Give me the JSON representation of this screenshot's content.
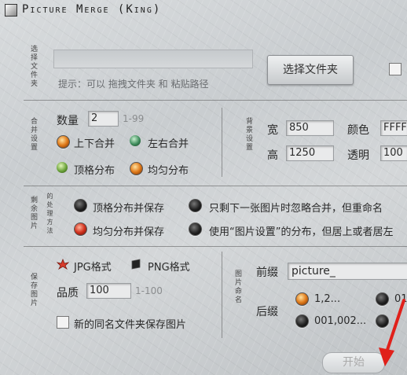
{
  "window": {
    "title": "Picture Merge (King)"
  },
  "folder": {
    "label": "选择文件夹",
    "path_value": "",
    "hint": "提示：可以 拖拽文件夹 和 粘贴路径",
    "select_button": "选择文件夹"
  },
  "merge": {
    "label": "合并设置",
    "count_label": "数量",
    "count_value": "2",
    "count_range": "1-99",
    "options": [
      "上下合并",
      "左右合并",
      "顶格分布",
      "均匀分布"
    ]
  },
  "bg": {
    "label": "背景设置",
    "width_label": "宽",
    "width_value": "850",
    "height_label": "高",
    "height_value": "1250",
    "color_label": "颜色",
    "color_value": "FFFF",
    "opacity_label": "透明",
    "opacity_value": "100"
  },
  "remainder": {
    "label_a": "剩余图片",
    "label_b": "的处理方法",
    "options": [
      "顶格分布并保存",
      "只剩下一张图片时忽略合并，但重命名",
      "均匀分布并保存",
      "使用“图片设置”的分布，但居上或者居左"
    ]
  },
  "save": {
    "label": "保存图片",
    "jpg": "JPG格式",
    "png": "PNG格式",
    "quality_label": "品质",
    "quality_value": "100",
    "quality_range": "1-100",
    "new_folder": "新的同名文件夹保存图片"
  },
  "naming": {
    "label": "图片命名",
    "prefix_label": "前缀",
    "prefix_value": "picture_",
    "suffix_label": "后缀",
    "opt1": "1,2...",
    "opt2": "001,002...",
    "opt3": "01"
  },
  "start_button": "开始"
}
